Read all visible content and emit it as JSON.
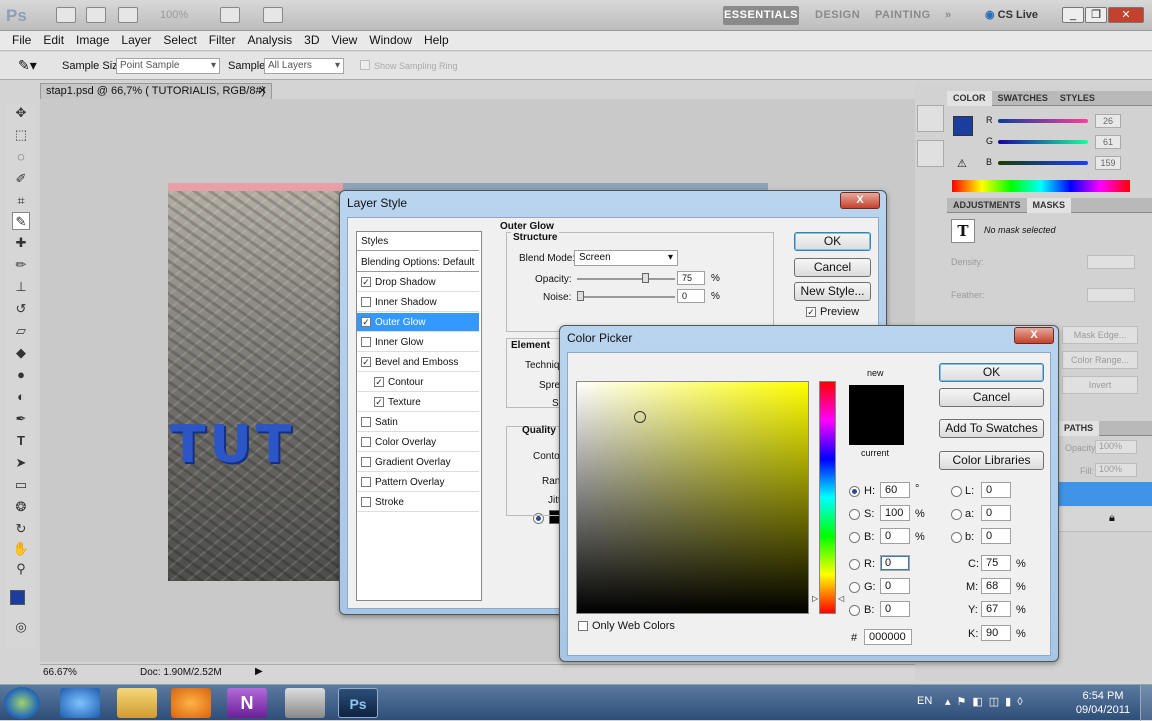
{
  "app": {
    "logo": "Ps",
    "zoom": "100%",
    "workspaces": [
      "ESSENTIALS",
      "DESIGN",
      "PAINTING"
    ],
    "cs_live": "CS Live",
    "menu": [
      "File",
      "Edit",
      "Image",
      "Layer",
      "Select",
      "Filter",
      "Analysis",
      "3D",
      "View",
      "Window",
      "Help"
    ]
  },
  "options": {
    "sample_size_label": "Sample Size:",
    "sample_size_value": "Point Sample",
    "sample_label": "Sample:",
    "sample_value": "All Layers",
    "show_ring": "Show Sampling Ring"
  },
  "document": {
    "tab": "stap1.psd @ 66,7% ( TUTORIALIS, RGB/8#) *",
    "canvas_text": "TUT",
    "zoom": "66.67%",
    "doc_size": "Doc: 1.90M/2.52M"
  },
  "panels": {
    "color_tabs": [
      "COLOR",
      "SWATCHES",
      "STYLES"
    ],
    "r_label": "R",
    "g_label": "G",
    "b_label": "B",
    "r": "26",
    "g": "61",
    "b": "159",
    "fg_color": "#1a3d9f",
    "adj_tabs": [
      "ADJUSTMENTS",
      "MASKS"
    ],
    "no_mask": "No mask selected",
    "density": "Density:",
    "feather": "Feather:",
    "mask_edge": "Mask Edge...",
    "color_range": "Color Range...",
    "invert": "Invert",
    "paths_tab": "PATHS",
    "opacity_lbl": "Opacity:",
    "opacity": "100%",
    "fill_lbl": "Fill:",
    "fill": "100%"
  },
  "layer_style": {
    "title": "Layer Style",
    "close": "X",
    "list_header": "Styles",
    "blending": "Blending Options: Default",
    "items": [
      {
        "label": "Drop Shadow",
        "checked": true,
        "indent": false,
        "active": false
      },
      {
        "label": "Inner Shadow",
        "checked": false,
        "indent": false,
        "active": false
      },
      {
        "label": "Outer Glow",
        "checked": true,
        "indent": false,
        "active": true
      },
      {
        "label": "Inner Glow",
        "checked": false,
        "indent": false,
        "active": false
      },
      {
        "label": "Bevel and Emboss",
        "checked": true,
        "indent": false,
        "active": false
      },
      {
        "label": "Contour",
        "checked": true,
        "indent": true,
        "active": false
      },
      {
        "label": "Texture",
        "checked": true,
        "indent": true,
        "active": false
      },
      {
        "label": "Satin",
        "checked": false,
        "indent": false,
        "active": false
      },
      {
        "label": "Color Overlay",
        "checked": false,
        "indent": false,
        "active": false
      },
      {
        "label": "Gradient Overlay",
        "checked": false,
        "indent": false,
        "active": false
      },
      {
        "label": "Pattern Overlay",
        "checked": false,
        "indent": false,
        "active": false
      },
      {
        "label": "Stroke",
        "checked": false,
        "indent": false,
        "active": false
      }
    ],
    "section": "Outer Glow",
    "structure": "Structure",
    "blend_mode_label": "Blend Mode:",
    "blend_mode": "Screen",
    "opacity_label": "Opacity:",
    "opacity": "75",
    "noise_label": "Noise:",
    "noise": "0",
    "percent": "%",
    "elements": "Element",
    "technique": "Techniqu",
    "spread": "Sprea",
    "size": "Si",
    "quality": "Quality",
    "contour": "Conto",
    "range": "Rang",
    "jitter": "Jitt",
    "ok": "OK",
    "cancel": "Cancel",
    "new_style": "New Style...",
    "preview": "Preview"
  },
  "color_picker": {
    "title": "Color Picker",
    "close": "X",
    "new_label": "new",
    "current_label": "current",
    "ok": "OK",
    "cancel": "Cancel",
    "add_swatches": "Add To Swatches",
    "color_libraries": "Color Libraries",
    "h": "60",
    "h_unit": "°",
    "s": "100",
    "s_unit": "%",
    "b": "0",
    "b_unit": "%",
    "r": "0",
    "g": "0",
    "bl": "0",
    "l": "0",
    "a": "0",
    "lab_b": "0",
    "c": "75",
    "m": "68",
    "y": "67",
    "k": "90",
    "hex": "000000",
    "only_web": "Only Web Colors",
    "labels": {
      "H": "H:",
      "S": "S:",
      "B": "B:",
      "R": "R:",
      "G": "G:",
      "Bl": "B:",
      "L": "L:",
      "a": "a:",
      "b": "b:",
      "C": "C:",
      "M": "M:",
      "Y": "Y:",
      "K": "K:",
      "hash": "#"
    },
    "hue_color": "#ffff00"
  },
  "taskbar": {
    "lang": "EN",
    "time": "6:54 PM",
    "date": "09/04/2011"
  }
}
